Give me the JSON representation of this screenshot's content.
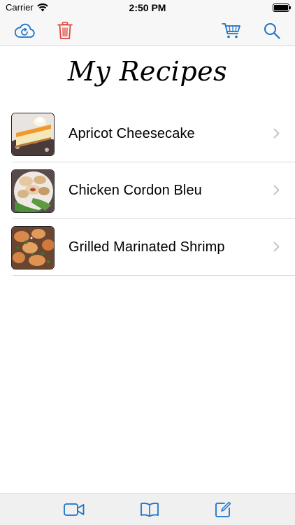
{
  "status_bar": {
    "carrier": "Carrier",
    "time": "2:50 PM",
    "battery_level": 1.0
  },
  "nav_bar": {
    "left_icons": [
      "cloud-sync-icon",
      "trash-icon"
    ],
    "right_icons": [
      "cart-icon",
      "search-icon"
    ]
  },
  "page": {
    "title": "My Recipes"
  },
  "recipes": [
    {
      "name": "Apricot Cheesecake",
      "thumbnail": "apricot-cheesecake-photo"
    },
    {
      "name": "Chicken Cordon Bleu",
      "thumbnail": "chicken-cordon-bleu-photo"
    },
    {
      "name": "Grilled Marinated Shrimp",
      "thumbnail": "grilled-shrimp-photo"
    }
  ],
  "tab_bar": {
    "icons": [
      "video-icon",
      "book-icon",
      "compose-icon"
    ]
  },
  "colors": {
    "accent_blue": "#1a73c8",
    "delete_red": "#e0443b",
    "bar_background": "#f7f7f7",
    "chevron_gray": "#c4c4c7"
  }
}
